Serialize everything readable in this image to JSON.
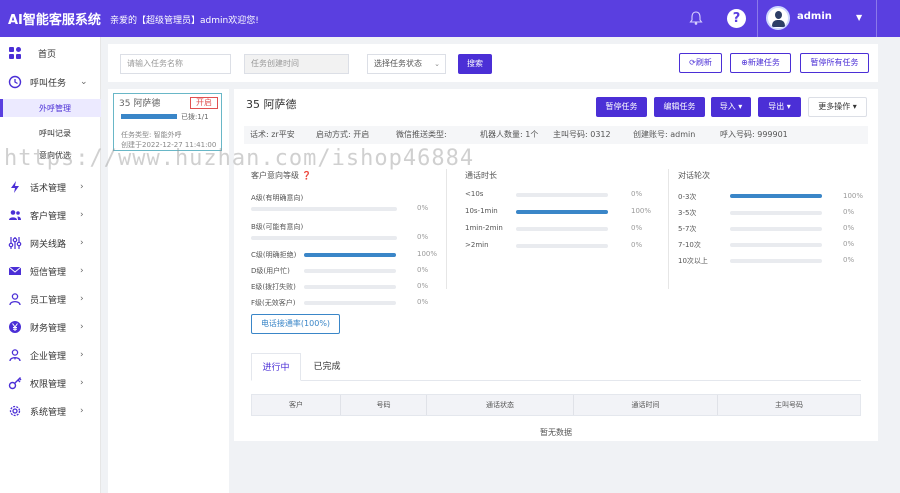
{
  "header": {
    "brand": "AI智能客服系统",
    "welcome": "亲爱的【超级管理员】admin欢迎您!",
    "username": "admin",
    "bell_icon": "bell-icon",
    "help_icon": "question-circle-icon",
    "accent": "#5a3fe0"
  },
  "sidebar": {
    "home": "首页",
    "call_tasks": "呼叫任务",
    "sub": {
      "outbound": "外呼管理",
      "call_records": "呼叫记录",
      "intent": "意向优选"
    },
    "items": [
      {
        "label": "话术管理",
        "icon": "bolt-icon"
      },
      {
        "label": "客户管理",
        "icon": "users-icon"
      },
      {
        "label": "网关线路",
        "icon": "sliders-icon"
      },
      {
        "label": "短信管理",
        "icon": "envelope-icon"
      },
      {
        "label": "员工管理",
        "icon": "user-icon"
      },
      {
        "label": "财务管理",
        "icon": "yen-icon"
      },
      {
        "label": "企业管理",
        "icon": "user-tie-icon"
      },
      {
        "label": "权限管理",
        "icon": "key-icon"
      },
      {
        "label": "系统管理",
        "icon": "gear-icon"
      }
    ]
  },
  "filters": {
    "task_name_placeholder": "请输入任务名称",
    "created_time_placeholder": "任务创建时间",
    "status_placeholder": "选择任务状态",
    "search": "搜索",
    "refresh": "刷新",
    "new_task": "新建任务",
    "pause_all": "暂停所有任务"
  },
  "task_card": {
    "name": "35 阿萨德",
    "status_tag": "开启",
    "ratio": "已拨:1/1",
    "progress": 1.0,
    "type": "任务类型: 智能外呼",
    "created": "创建于2022-12-27 11:41:00"
  },
  "main": {
    "title": "35 阿萨德",
    "buttons": {
      "pause": "暂停任务",
      "edit": "编辑任务",
      "import": "导入",
      "export": "导出",
      "more": "更多操作"
    },
    "info": {
      "script": "话术: zr平安",
      "start_mode": "启动方式: 开启",
      "wechat_push": "微信推送类型:",
      "robots": "机器人数量: 1个",
      "caller": "主叫号码: 0312",
      "creator": "创建账号: admin",
      "dial_no": "呼入号码: 999901"
    },
    "intent": {
      "title": "客户意向等级",
      "rows": [
        {
          "label": "A级(有明确意向)",
          "pct": "0%",
          "value": 0
        },
        {
          "label": "B级(可能有意向)",
          "pct": "0%",
          "value": 0
        },
        {
          "label": "C级(明确拒绝)",
          "pct": "100%",
          "value": 100
        },
        {
          "label": "D级(用户忙)",
          "pct": "0%",
          "value": 0
        },
        {
          "label": "E级(拨打失败)",
          "pct": "0%",
          "value": 0
        },
        {
          "label": "F级(无效客户)",
          "pct": "0%",
          "value": 0
        }
      ],
      "connect_rate": "电话接通率(100%)"
    },
    "duration": {
      "title": "通话时长",
      "rows": [
        {
          "label": "<10s",
          "pct": "0%",
          "value": 0
        },
        {
          "label": "10s-1min",
          "pct": "100%",
          "value": 100
        },
        {
          "label": "1min-2min",
          "pct": "0%",
          "value": 0
        },
        {
          "label": ">2min",
          "pct": "0%",
          "value": 0
        }
      ]
    },
    "rounds": {
      "title": "对话轮次",
      "rows": [
        {
          "label": "0-3次",
          "pct": "100%",
          "value": 100
        },
        {
          "label": "3-5次",
          "pct": "0%",
          "value": 0
        },
        {
          "label": "5-7次",
          "pct": "0%",
          "value": 0
        },
        {
          "label": "7-10次",
          "pct": "0%",
          "value": 0
        },
        {
          "label": "10次以上",
          "pct": "0%",
          "value": 0
        }
      ]
    },
    "tabs": [
      "进行中",
      "已完成"
    ],
    "table": {
      "columns": [
        "客户",
        "号码",
        "通话状态",
        "通话时间",
        "主叫号码"
      ],
      "empty": "暂无数据"
    }
  },
  "watermark": "https://www.huzhan.com/ishop46884"
}
